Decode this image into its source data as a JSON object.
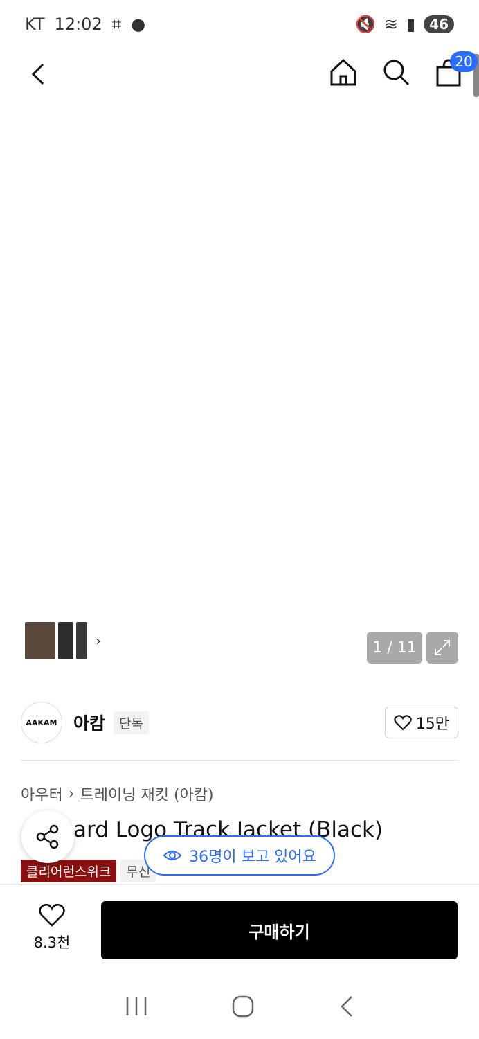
{
  "status_bar": {
    "carrier": "KT",
    "time": "12:02",
    "battery": "46"
  },
  "header": {
    "cart_count": "20"
  },
  "gallery": {
    "counter": "1 / 11"
  },
  "brand": {
    "logo_text": "AAKAM",
    "name": "아캄",
    "tag": "단독",
    "likes": "15만"
  },
  "breadcrumb": {
    "category": "아우터",
    "subcategory": "트레이닝 재킷 (아캄)"
  },
  "product": {
    "title": "ard Logo Track Jacket (Black)",
    "tags": [
      "클리어런스위크",
      "무신"
    ]
  },
  "viewers_text": "36명이 보고 있어요",
  "bottom_bar": {
    "wish_count": "8.3천",
    "buy_label": "구매하기"
  },
  "colors": {
    "accent": "#2a6cff",
    "tag_red": "#8b1010",
    "buy": "#000000"
  }
}
